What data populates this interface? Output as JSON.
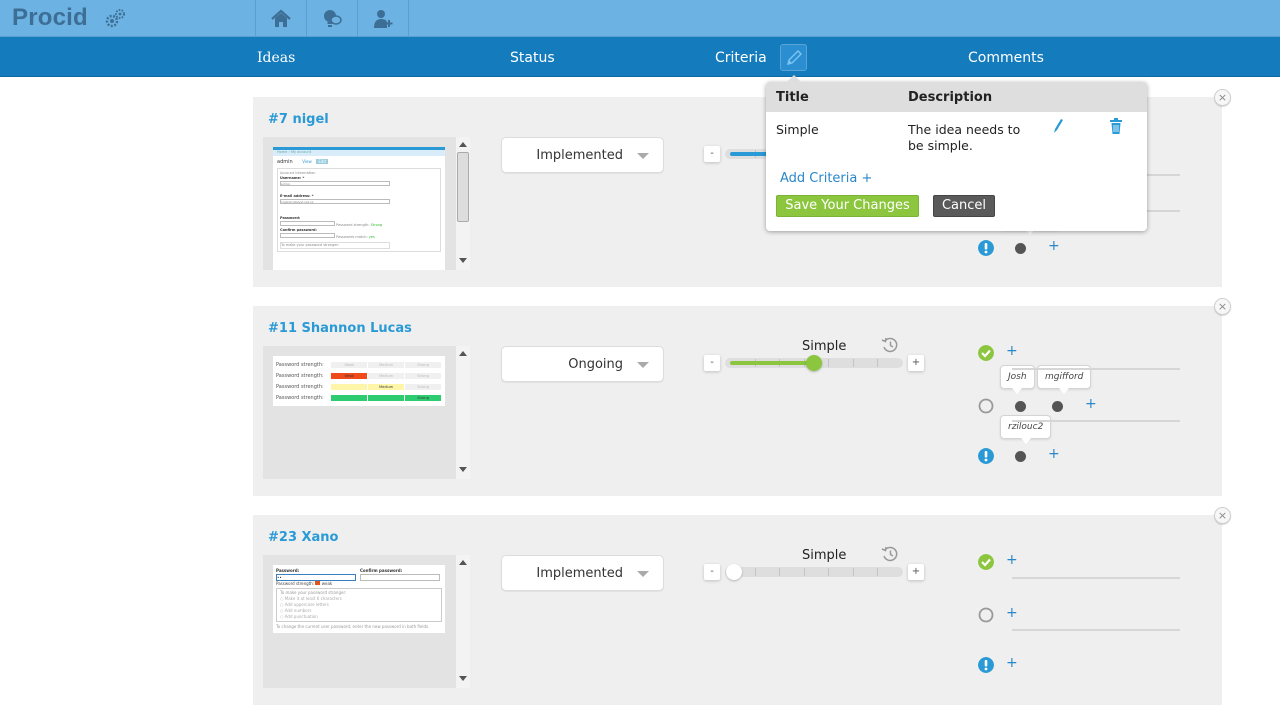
{
  "app": {
    "name": "Procid",
    "logo_icon": "gears-icon",
    "nav_buttons": [
      {
        "name": "home",
        "icon": "home-icon"
      },
      {
        "name": "ideas",
        "icon": "lightbulb-chat-icon"
      },
      {
        "name": "invite",
        "icon": "add-user-icon"
      }
    ]
  },
  "columns": {
    "ideas": "Ideas",
    "status": "Status",
    "criteria": "Criteria",
    "comments": "Comments"
  },
  "criteria_popup": {
    "headers": {
      "title": "Title",
      "description": "Description"
    },
    "rows": [
      {
        "title": "Simple",
        "description_line1": "The idea needs to",
        "description_line2": "be simple."
      }
    ],
    "add_label": "Add Criteria +",
    "save_label": "Save Your Changes",
    "cancel_label": "Cancel"
  },
  "ideas": [
    {
      "title": "#7 nigel",
      "status": "Implemented",
      "criterion": "Simple",
      "slider_value_fraction": 0.45,
      "slider_color": "#2a9ad7",
      "votes": {
        "support": {
          "voters": []
        },
        "neutral": {
          "voters": []
        },
        "concern": {
          "voters": [
            "(hidden)"
          ]
        }
      },
      "thumbnail": {
        "breadcrumb": "Home › My account",
        "user": "admin",
        "tabs": [
          "View",
          "Edit"
        ],
        "section": "Account information",
        "username_label": "Username: *",
        "username_value": "admin",
        "email_label": "E-mail address: *",
        "email_value": "nigel@catalyst.net.nz",
        "password_label": "Password:",
        "strength_label": "Password strength:",
        "strength_value": "Strong",
        "confirm_label": "Confirm password:",
        "match_label": "Passwords match:",
        "match_value": "yes",
        "hint": "To make your password stronger:"
      }
    },
    {
      "title": "#11 Shannon Lucas",
      "status": "Ongoing",
      "criterion": "Simple",
      "slider_value_fraction": 0.5,
      "slider_color": "#8cc63f",
      "votes": {
        "support": {
          "voters": []
        },
        "neutral": {
          "voters": [
            "Josh",
            "mgifford"
          ]
        },
        "concern": {
          "voters": [
            "rzilouc2"
          ]
        }
      },
      "thumbnail": {
        "rows": [
          {
            "label": "Password strength:",
            "segments": [
              "Weak",
              "Medium",
              "Strong"
            ],
            "active": ""
          },
          {
            "label": "Password strength:",
            "segments": [
              "Weak",
              "Medium",
              "Strong"
            ],
            "active": "Weak"
          },
          {
            "label": "Password strength:",
            "segments": [
              "",
              "Medium",
              "Strong"
            ],
            "active": "Medium"
          },
          {
            "label": "Password strength:",
            "segments": [
              "",
              "",
              "Strong"
            ],
            "active": "Strong"
          }
        ]
      }
    },
    {
      "title": "#23 Xano",
      "status": "Implemented",
      "criterion": "Simple",
      "slider_value_fraction": 0.0,
      "slider_color": "#ffffff",
      "votes": {
        "support": {
          "voters": []
        },
        "neutral": {
          "voters": []
        },
        "concern": {
          "voters": []
        }
      },
      "thumbnail": {
        "password_label": "Password:",
        "confirm_label": "Confirm password:",
        "password_value": "••",
        "strength_label": "Password strength:",
        "strength_value": "weak",
        "hint": "To make your password stronger:",
        "tips": [
          "Make it at least 6 characters",
          "Add uppercase letters",
          "Add numbers",
          "Add punctuation"
        ],
        "footer": "To change the current user password, enter the new password in both fields."
      }
    }
  ],
  "colors": {
    "topbar": "#6cb2e2",
    "column_bar": "#147bbd",
    "accent": "#2a9ad7",
    "support": "#8cc63f",
    "concern": "#2a9ad7",
    "save": "#8cc63f",
    "cancel": "#5a5a5a"
  }
}
